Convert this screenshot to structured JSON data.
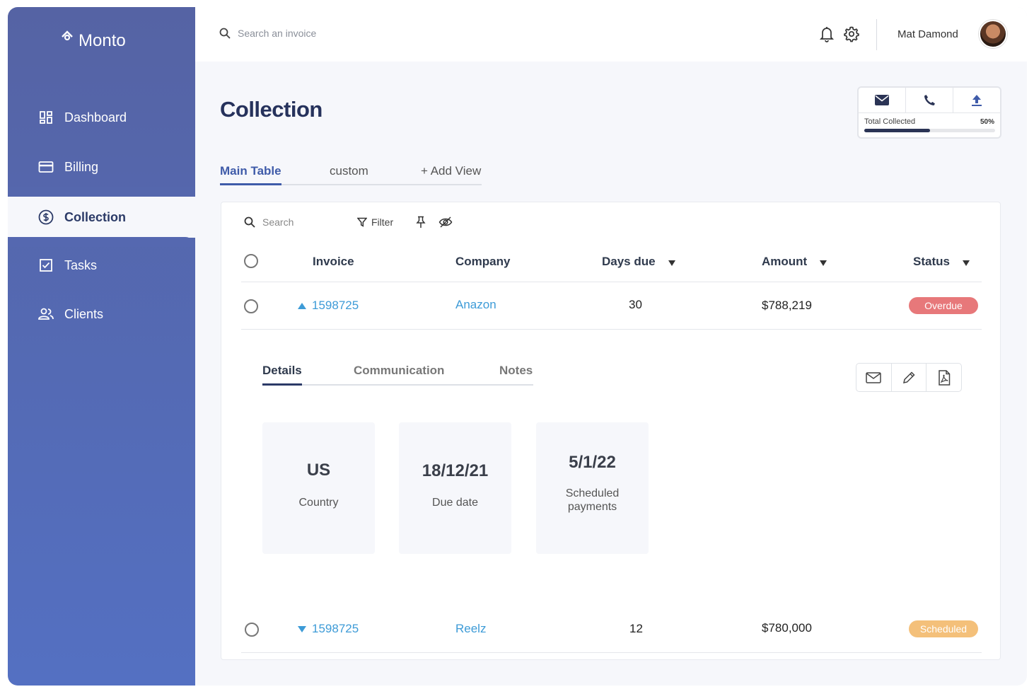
{
  "app": {
    "logo": "Monto"
  },
  "sidebar": {
    "items": [
      {
        "label": "Dashboard",
        "icon": "dashboard-icon"
      },
      {
        "label": "Billing",
        "icon": "card-icon"
      },
      {
        "label": "Collection",
        "icon": "dollar-icon",
        "active": true
      },
      {
        "label": "Tasks",
        "icon": "checkbox-icon"
      },
      {
        "label": "Clients",
        "icon": "users-icon"
      }
    ]
  },
  "topbar": {
    "search_placeholder": "Search an invoice",
    "user_name": "Mat Damond"
  },
  "page": {
    "title": "Collection"
  },
  "widget": {
    "label": "Total Collected",
    "percent_text": "50%",
    "percent": 50
  },
  "view_tabs": [
    "Main Table",
    "custom",
    "+ Add View"
  ],
  "toolbar": {
    "search": "Search",
    "filter": "Filter"
  },
  "table": {
    "headers": [
      "Invoice",
      "Company",
      "Days due",
      "Amount",
      "Status"
    ],
    "rows": [
      {
        "invoice": "1598725",
        "company": "Anazon",
        "days_due": "30",
        "amount": "$788,219",
        "status": "Overdue",
        "status_color": "#e7787a",
        "expanded": true
      },
      {
        "invoice": "1598725",
        "company": "Reelz",
        "days_due": "12",
        "amount": "$780,000",
        "status": "Scheduled",
        "status_color": "#f4c07a",
        "expanded": false
      }
    ]
  },
  "details": {
    "tabs": [
      "Details",
      "Communication",
      "Notes"
    ],
    "cards": [
      {
        "value": "US",
        "label": "Country"
      },
      {
        "value": "18/12/21",
        "label": "Due date"
      },
      {
        "value": "5/1/22",
        "label": "Scheduled payments"
      }
    ]
  },
  "colors": {
    "accent": "#3f5ba9",
    "sidebar": "#5470c2",
    "link": "#3d9bd7"
  }
}
